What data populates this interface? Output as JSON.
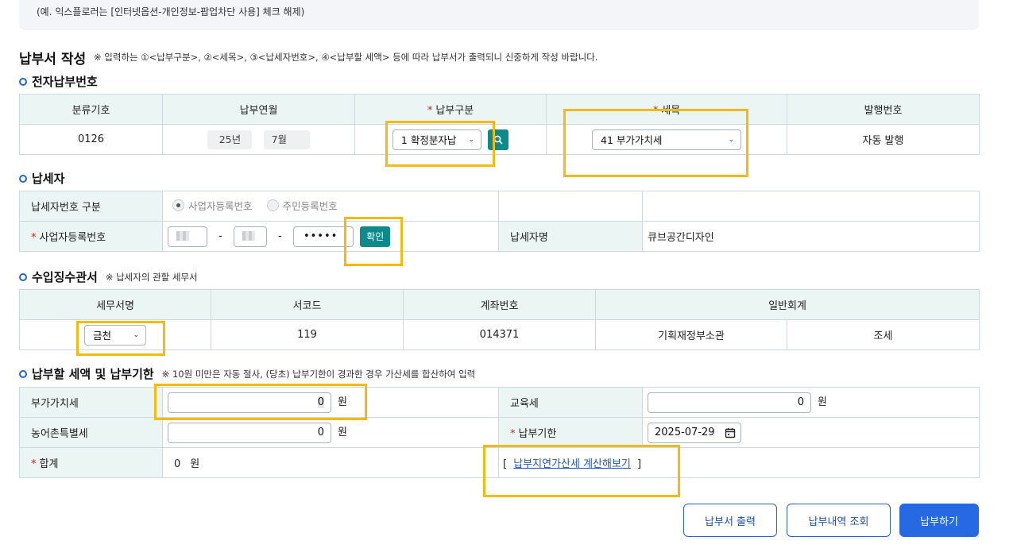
{
  "notice": "(예. 익스플로러는 [인터넷옵션-개인정보-팝업차단 사용] 체크 해제)",
  "page_title": "납부서 작성",
  "page_desc": "※ 입력하는 ①<납부구분>, ②<세목>, ③<납세자번호>, ④<납부할 세액> 등에 따라 납부서가 출력되니 신중하게 작성 바랍니다.",
  "electronic_payment": {
    "title": "전자납부번호",
    "headers": [
      "분류기호",
      "납부연월",
      "납부구분",
      "세목",
      "발행번호"
    ],
    "class_code": "0126",
    "year": "25년",
    "month": "7월",
    "payment_type": "1 확정분자납",
    "tax_item": "41 부가가치세",
    "issue_number": "자동 발행"
  },
  "taxpayer": {
    "title": "납세자",
    "id_type_label": "납세자번호 구분",
    "radio_business": "사업자등록번호",
    "radio_resident": "주민등록번호",
    "biz_no_label": "사업자등록번호",
    "dash": "-",
    "biz_no_part3": "•••••",
    "confirm_label": "확인",
    "name_label": "납세자명",
    "name_value": "큐브공간디자인"
  },
  "collection_office": {
    "title": "수입징수관서",
    "note": "※ 납세자의 관할 세무서",
    "headers": [
      "세무서명",
      "서코드",
      "계좌번호",
      "일반회계"
    ],
    "office_name": "금천",
    "office_code": "119",
    "account_no": "014371",
    "accounting_1": "기획재정부소관",
    "accounting_2": "조세"
  },
  "tax_amount": {
    "title": "납부할 세액 및 납부기한",
    "note": "※ 10원 미만은 자동 절사, (당초) 납부기한이 경과한 경우 가산세를 합산하여 입력",
    "vat_label": "부가가치세",
    "vat_value": "0",
    "edu_label": "교육세",
    "edu_value": "0",
    "rural_label": "농어촌특별세",
    "rural_value": "0",
    "deadline_label": "납부기한",
    "deadline_value": "2025-07-29",
    "total_label": "합계",
    "total_value": "0",
    "unit": "원",
    "bracket_open": "[",
    "late_fee_link": "납부지연가산세 계산해보기",
    "bracket_close": "]"
  },
  "buttons": {
    "print": "납부서 출력",
    "history": "납부내역 조회",
    "pay": "납부하기"
  },
  "colors": {
    "accent": "#2768e3",
    "teal": "#0e8a8c",
    "highlight": "#f6b90f",
    "header_bg": "#eaf5f4"
  }
}
